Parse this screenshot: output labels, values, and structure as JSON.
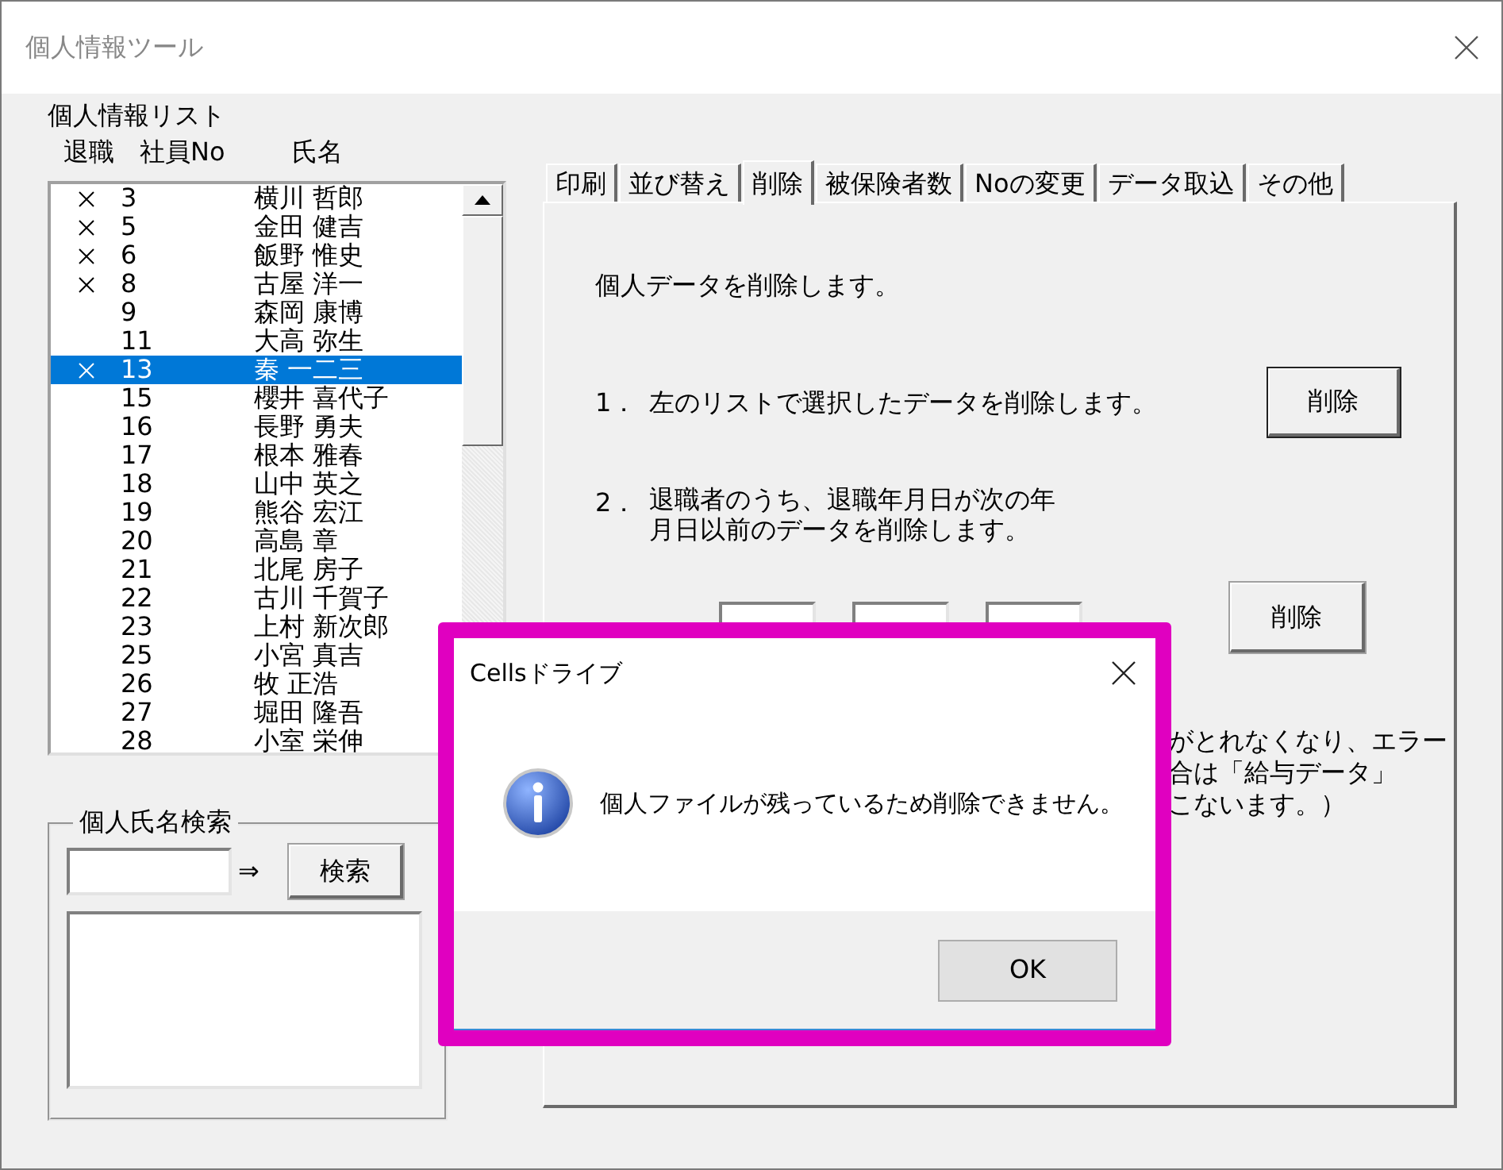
{
  "window": {
    "title": "個人情報ツール"
  },
  "list": {
    "title": "個人情報リスト",
    "columns": [
      "退職",
      "社員No",
      "氏名"
    ],
    "rows": [
      {
        "retired": true,
        "no": "3",
        "name": "横川 哲郎",
        "selected": false
      },
      {
        "retired": true,
        "no": "5",
        "name": "金田 健吉",
        "selected": false
      },
      {
        "retired": true,
        "no": "6",
        "name": "飯野 惟史",
        "selected": false
      },
      {
        "retired": true,
        "no": "8",
        "name": "古屋 洋一",
        "selected": false
      },
      {
        "retired": false,
        "no": "9",
        "name": "森岡 康博",
        "selected": false
      },
      {
        "retired": false,
        "no": "11",
        "name": "大高 弥生",
        "selected": false
      },
      {
        "retired": true,
        "no": "13",
        "name": "秦 一二三",
        "selected": true
      },
      {
        "retired": false,
        "no": "15",
        "name": "櫻井 喜代子",
        "selected": false
      },
      {
        "retired": false,
        "no": "16",
        "name": "長野 勇夫",
        "selected": false
      },
      {
        "retired": false,
        "no": "17",
        "name": "根本 雅春",
        "selected": false
      },
      {
        "retired": false,
        "no": "18",
        "name": "山中 英之",
        "selected": false
      },
      {
        "retired": false,
        "no": "19",
        "name": "熊谷 宏江",
        "selected": false
      },
      {
        "retired": false,
        "no": "20",
        "name": "高島 章",
        "selected": false
      },
      {
        "retired": false,
        "no": "21",
        "name": "北尾 房子",
        "selected": false
      },
      {
        "retired": false,
        "no": "22",
        "name": "古川 千賀子",
        "selected": false
      },
      {
        "retired": false,
        "no": "23",
        "name": "上村 新次郎",
        "selected": false
      },
      {
        "retired": false,
        "no": "25",
        "name": "小宮 真吉",
        "selected": false
      },
      {
        "retired": false,
        "no": "26",
        "name": "牧 正浩",
        "selected": false
      },
      {
        "retired": false,
        "no": "27",
        "name": "堀田 隆吾",
        "selected": false
      },
      {
        "retired": false,
        "no": "28",
        "name": "小室 栄伸",
        "selected": false
      }
    ]
  },
  "search": {
    "title": "個人氏名検索",
    "arrow": "⇒",
    "button": "検索"
  },
  "tabs": [
    {
      "label": "印刷",
      "selected": false
    },
    {
      "label": "並び替え",
      "selected": false
    },
    {
      "label": "削除",
      "selected": true
    },
    {
      "label": "被保険者数",
      "selected": false
    },
    {
      "label": "Noの変更",
      "selected": false
    },
    {
      "label": "データ取込",
      "selected": false
    },
    {
      "label": "その他",
      "selected": false
    }
  ],
  "panel": {
    "intro": "個人データを削除します。",
    "step_1": {
      "number": "1．",
      "text": "左のリストで選択したデータを削除します。",
      "button": "削除"
    },
    "step_2": {
      "number": "2．",
      "lines": [
        "退職者のうち、退職年月日が次の年",
        "月日以前のデータを削除します。"
      ]
    },
    "date_row": {
      "button": "削除"
    },
    "note_lines": [
      "がとれなくなり、エラー",
      "合は「給与データ」",
      "こないます。）"
    ]
  },
  "dialog": {
    "title": "Cellsドライブ",
    "message": "個人ファイルが残っているため削除できません。",
    "ok": "OK"
  }
}
